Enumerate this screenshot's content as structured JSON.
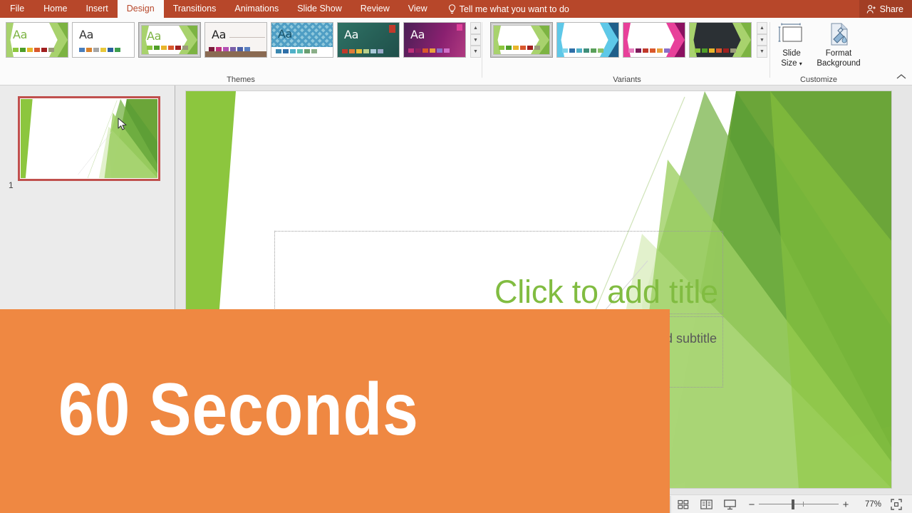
{
  "window": {
    "app": "PowerPoint"
  },
  "ribbon": {
    "tabs": [
      {
        "label": "File",
        "active": false
      },
      {
        "label": "Home",
        "active": false
      },
      {
        "label": "Insert",
        "active": false
      },
      {
        "label": "Design",
        "active": true
      },
      {
        "label": "Transitions",
        "active": false
      },
      {
        "label": "Animations",
        "active": false
      },
      {
        "label": "Slide Show",
        "active": false
      },
      {
        "label": "Review",
        "active": false
      },
      {
        "label": "View",
        "active": false
      }
    ],
    "tell_me": "Tell me what you want to do",
    "share": "Share",
    "accent_color": "#b7472a",
    "groups": {
      "themes": {
        "label": "Themes",
        "items": [
          {
            "name": "theme-facet-green",
            "aa": "Aa",
            "aa_color": "#7cb342",
            "bg": "#ffffff",
            "swatches": [
              "#8cc63e",
              "#4f9e28",
              "#e8b52a",
              "#d9582c",
              "#a01f1f",
              "#9a9a7a"
            ],
            "style": "facet",
            "selected": false
          },
          {
            "name": "theme-office-plain",
            "aa": "Aa",
            "aa_color": "#333333",
            "bg": "#ffffff",
            "swatches": [
              "#4a7ebb",
              "#d9832c",
              "#a6a6a6",
              "#e8c83c",
              "#2b5f9e",
              "#3f9e4d"
            ],
            "style": "plain",
            "selected": false
          },
          {
            "name": "theme-facet-green-selected",
            "aa": "Aa",
            "aa_color": "#7cb342",
            "bg": "#ffffff",
            "swatches": [
              "#8cc63e",
              "#4f9e28",
              "#e8b52a",
              "#d9582c",
              "#a01f1f",
              "#9a9a7a"
            ],
            "style": "facet",
            "selected": true
          },
          {
            "name": "theme-wisp",
            "aa": "Aa",
            "aa_color": "#222222",
            "bg": "#f5f1ef",
            "swatches": [
              "#7b1a3a",
              "#c0307a",
              "#b44fb4",
              "#7a5fa8",
              "#4a5fa8",
              "#5a7fbf"
            ],
            "style": "wisp",
            "selected": false
          },
          {
            "name": "theme-dividend",
            "aa": "Aa",
            "aa_color": "#17536b",
            "bg": "#6fb6cf",
            "swatches": [
              "#3a87b0",
              "#2f6fa8",
              "#4fb0c8",
              "#5fbfb0",
              "#6a9e70",
              "#8aae88"
            ],
            "style": "pattern",
            "selected": false
          },
          {
            "name": "theme-badge",
            "aa": "Aa",
            "aa_color": "#ffffff",
            "bg": "#2c6a5e",
            "swatches": [
              "#c0392b",
              "#e07b39",
              "#e8c03c",
              "#b8cf8a",
              "#a8c8d8",
              "#9aa8c8"
            ],
            "style": "dark",
            "selected": false
          },
          {
            "name": "theme-vapor-trail",
            "aa": "Aa",
            "aa_color": "#ffffff",
            "bg": "#6b1f66",
            "swatches": [
              "#c0307a",
              "#8a2060",
              "#d9582c",
              "#e8a03c",
              "#8a6fc8",
              "#d06fc8"
            ],
            "style": "purple",
            "selected": false
          }
        ]
      },
      "variants": {
        "label": "Variants",
        "items": [
          {
            "name": "variant-green",
            "accent": "#8cc63e",
            "dark": "#4f9e28",
            "swatches": [
              "#8cc63e",
              "#4f9e28",
              "#e8b52a",
              "#d9582c",
              "#a01f1f",
              "#9a9a7a"
            ],
            "bg": "#ffffff",
            "selected": true
          },
          {
            "name": "variant-blue",
            "accent": "#4fc3e8",
            "dark": "#1f5f8a",
            "swatches": [
              "#7fd4ea",
              "#2f6fa8",
              "#4fb0c8",
              "#3f8f7a",
              "#5aa05a",
              "#8ac06a"
            ],
            "bg": "#ffffff",
            "selected": false
          },
          {
            "name": "variant-pink",
            "accent": "#e8409a",
            "dark": "#9a1060",
            "swatches": [
              "#e87fbf",
              "#7b1a5a",
              "#c0392b",
              "#d9582c",
              "#e8a03c",
              "#8a6fc8"
            ],
            "swatch_bg": "#ffffff",
            "selected": false
          },
          {
            "name": "variant-dark",
            "accent": "#8cc63e",
            "dark": "#4f9e28",
            "swatches": [
              "#8cc63e",
              "#4f9e28",
              "#e8b52a",
              "#d9582c",
              "#a01f1f",
              "#9a9a7a"
            ],
            "bg": "#2b3034",
            "selected": false
          }
        ]
      },
      "customize": {
        "label": "Customize",
        "slide_size": "Slide\nSize",
        "slide_size_line1": "Slide",
        "slide_size_line2": "Size",
        "format_background_line1": "Format",
        "format_background_line2": "Background"
      }
    }
  },
  "slide_panel": {
    "slides": [
      {
        "number": "1",
        "selected": true
      }
    ]
  },
  "slide": {
    "title_placeholder": "Click to add title",
    "subtitle_placeholder": "Click to add subtitle",
    "subtitle_visible_fragment": "subtitle",
    "theme_colors": {
      "light_green": "#a8d26d",
      "mid_green": "#8cc63e",
      "dark_green": "#6ba539",
      "deep_green": "#5d9e36",
      "pale_green": "#dff0c8",
      "title_green": "#81bc41",
      "subtitle_gray": "#595959"
    }
  },
  "status_bar": {
    "views": [
      {
        "name": "normal-view",
        "icon": "normal-view-icon",
        "active": true
      },
      {
        "name": "slide-sorter-view",
        "icon": "slide-sorter-icon",
        "active": false
      },
      {
        "name": "reading-view",
        "icon": "reading-view-icon",
        "active": false
      },
      {
        "name": "slide-show-view",
        "icon": "slide-show-icon",
        "active": false
      }
    ],
    "zoom_out": "−",
    "zoom_in": "+",
    "zoom_level": "77%",
    "fit_label": "Fit slide to current window"
  },
  "overlay": {
    "text": "60 Seconds",
    "bg_color": "#ef8842",
    "text_color": "#ffffff"
  }
}
